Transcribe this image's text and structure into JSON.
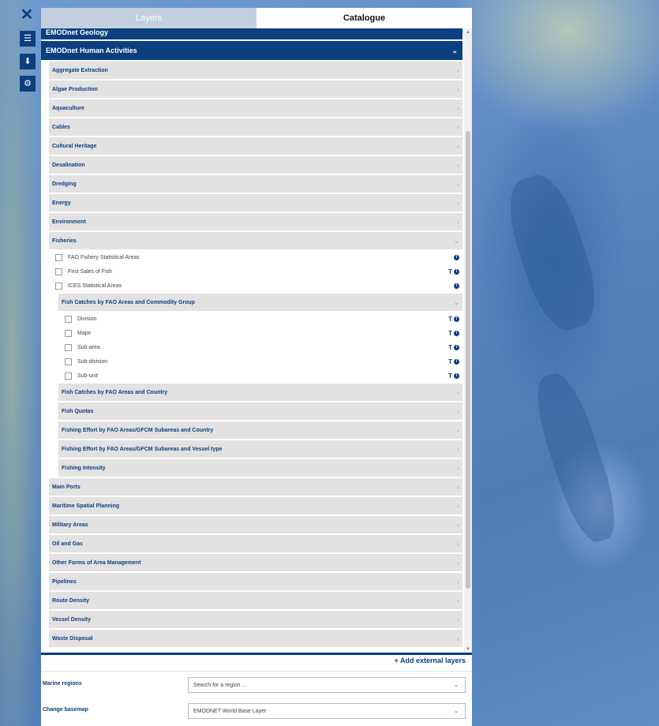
{
  "tabs": {
    "layers": "Layers",
    "catalogue": "Catalogue"
  },
  "catalogue": {
    "cut_top": "EMODnet Geology",
    "header": "EMODnet Human Activities",
    "items": [
      "Aggregate Extraction",
      "Algae Production",
      "Aquaculture",
      "Cables",
      "Cultural Heritage",
      "Desalination",
      "Dredging",
      "Energy",
      "Environment"
    ],
    "fisheries": {
      "label": "Fisheries",
      "leaves": [
        "FAO Fishery Statistical Areas",
        "First Sales of Fish",
        "ICES Statistical Areas"
      ],
      "fish_catch_group": {
        "label": "Fish Catches by FAO Areas and Commodity Group",
        "leaves": [
          "Division",
          "Major",
          "Sub-area",
          "Sub-division",
          "Sub-unit"
        ]
      },
      "sub_items": [
        "Fish Catches by FAO Areas and Country",
        "Fish Quotas",
        "Fishing Effort by FAO Areas/GFCM Subareas and Country",
        "Fishing Effort by FAO Areas/GFCM Subareas and Vessel type",
        "Fishing Intensity"
      ]
    },
    "items_after": [
      "Main Ports",
      "Maritime Spatial Planning",
      "Military Areas",
      "Oil and Gas",
      "Other Forms of Area Management",
      "Pipelines",
      "Route Density",
      "Vessel Density",
      "Waste Disposal"
    ]
  },
  "glyphs": {
    "close": "✕",
    "right": "›",
    "down": "⌄",
    "plus": "+",
    "table_tool": "T",
    "info": "i"
  },
  "add_external": "Add external layers",
  "marine_regions": {
    "label": "Marine regions",
    "placeholder": "Search for a region ..."
  },
  "basemap": {
    "label": "Change basemap",
    "value": "EMODNET World Base Layer"
  }
}
